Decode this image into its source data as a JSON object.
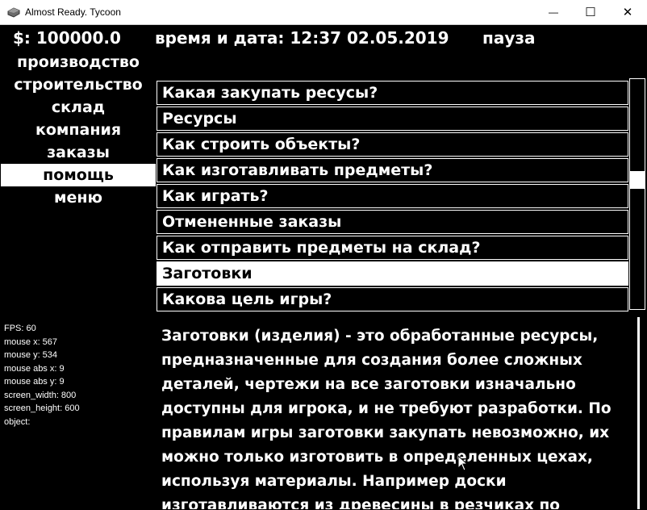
{
  "window": {
    "title": "Almost Ready. Tycoon",
    "minimize_glyph": "—",
    "maximize_glyph": "☐",
    "close_glyph": "✕"
  },
  "hud": {
    "money": "$: 100000.0",
    "datetime": "время и дата: 12:37 02.05.2019",
    "pause": "пауза"
  },
  "menu": {
    "items": [
      {
        "label": "производство"
      },
      {
        "label": "строительство"
      },
      {
        "label": "склад"
      },
      {
        "label": "компания"
      },
      {
        "label": "заказы"
      },
      {
        "label": "помощь",
        "active": true
      },
      {
        "label": "меню"
      }
    ]
  },
  "help": {
    "topics": [
      {
        "label": "Какая закупать ресусы?"
      },
      {
        "label": "Ресурсы"
      },
      {
        "label": "Как строить объекты?"
      },
      {
        "label": "Как изготавливать предметы?"
      },
      {
        "label": "Как играть?"
      },
      {
        "label": "Отмененные заказы"
      },
      {
        "label": "Как отправить предметы на склад?"
      },
      {
        "label": "Заготовки",
        "active": true
      },
      {
        "label": "Какова цель игры?"
      }
    ],
    "description_lines": [
      "Заготовки (изделия) - это обработанные ресурсы,",
      "предназначенные для создания более сложных",
      "деталей, чертежи на все заготовки изначально",
      "доступны для игрока, и не требуют разработки. По",
      "правилам игры заготовки закупать невозможно, их",
      "можно только изготовить в определенных цехах,",
      "используя материалы. Например доски",
      "изготавливаются из древесины в резчиках по"
    ]
  },
  "debug": {
    "lines": [
      "FPS: 60",
      "mouse x: 567",
      "mouse y: 534",
      "mouse abs x: 9",
      "mouse abs y: 9",
      "screen_width: 800",
      "screen_height: 600",
      "object:"
    ]
  },
  "colors": {
    "background": "#000000",
    "foreground": "#ffffff",
    "titlebar": "#ffffff"
  }
}
